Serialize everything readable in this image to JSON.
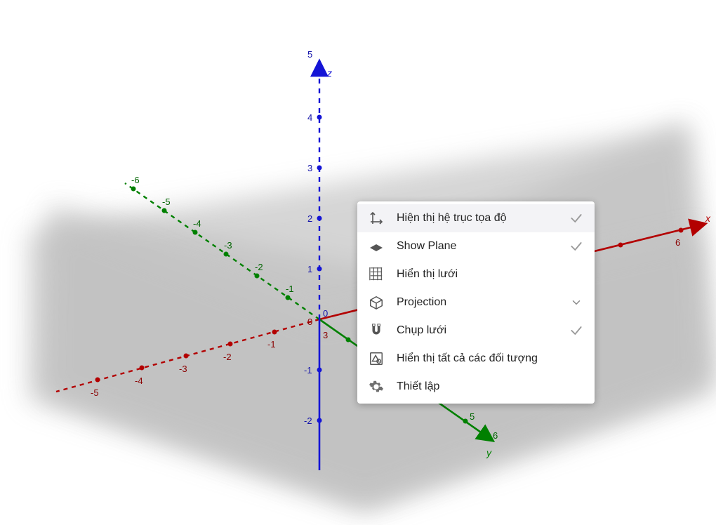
{
  "axes": {
    "x": {
      "label": "x",
      "color": "#b30000"
    },
    "y": {
      "label": "y",
      "color": "#008000"
    },
    "z": {
      "label": "z",
      "color": "#1414d6"
    }
  },
  "ticks": {
    "z_pos": [
      "1",
      "2",
      "3",
      "4",
      "5"
    ],
    "z_neg": [
      "-1",
      "-2"
    ],
    "y_pos": [
      "5",
      "6"
    ],
    "y_neg": [
      "-1",
      "-2",
      "-3",
      "-4",
      "-5",
      "-6"
    ],
    "x_pos": [
      "6"
    ],
    "x_neg": [
      "-1",
      "-2",
      "-3",
      "-4",
      "-5"
    ],
    "z_origin": "0",
    "x_origin": "0",
    "behind_origin": "3"
  },
  "menu": {
    "items": [
      {
        "label": "Hiện thị hệ trục tọa độ",
        "checked": true
      },
      {
        "label": "Show Plane",
        "checked": true
      },
      {
        "label": "Hiển thị lưới"
      },
      {
        "label": "Projection",
        "submenu": true
      },
      {
        "label": "Chụp lưới",
        "checked": true
      },
      {
        "label": "Hiển thị tất cả các đối tượng"
      },
      {
        "label": "Thiết lập"
      }
    ]
  },
  "chart_data": {
    "type": "3d-axes",
    "title": "",
    "xlabel": "x",
    "ylabel": "y",
    "zlabel": "z",
    "x_range": [
      -5,
      6
    ],
    "y_range": [
      -6,
      6
    ],
    "z_range": [
      -2,
      5
    ],
    "plane": "xy",
    "series": []
  }
}
